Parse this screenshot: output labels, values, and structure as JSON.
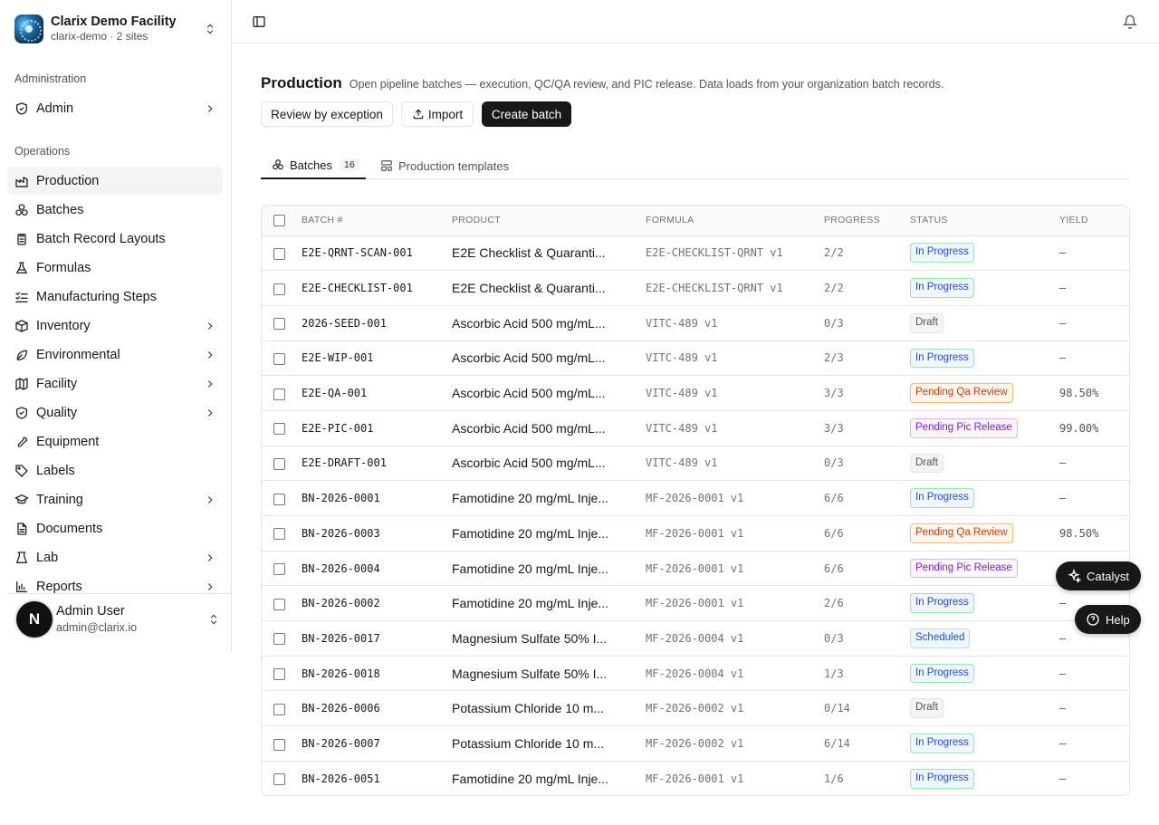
{
  "org": {
    "name": "Clarix Demo Facility",
    "sub": "clarix-demo · 2 sites"
  },
  "sections": {
    "admin": "Administration",
    "operations": "Operations"
  },
  "admin_item": {
    "label": "Admin"
  },
  "nav": [
    {
      "label": "Production",
      "icon": "factory-icon",
      "chevron": false,
      "active": true
    },
    {
      "label": "Batches",
      "icon": "batches-icon",
      "chevron": false
    },
    {
      "label": "Batch Record Layouts",
      "icon": "clipboard-icon",
      "chevron": false
    },
    {
      "label": "Formulas",
      "icon": "flask-icon",
      "chevron": false
    },
    {
      "label": "Manufacturing Steps",
      "icon": "list-checks-icon",
      "chevron": false
    },
    {
      "label": "Inventory",
      "icon": "box-icon",
      "chevron": true
    },
    {
      "label": "Environmental",
      "icon": "leaf-icon",
      "chevron": true
    },
    {
      "label": "Facility",
      "icon": "map-icon",
      "chevron": true
    },
    {
      "label": "Quality",
      "icon": "shield-check-icon",
      "chevron": true
    },
    {
      "label": "Equipment",
      "icon": "wrench-icon",
      "chevron": false
    },
    {
      "label": "Labels",
      "icon": "tag-icon",
      "chevron": false
    },
    {
      "label": "Training",
      "icon": "graduation-cap-icon",
      "chevron": true
    },
    {
      "label": "Documents",
      "icon": "file-icon",
      "chevron": false
    },
    {
      "label": "Lab",
      "icon": "beaker-icon",
      "chevron": true
    },
    {
      "label": "Reports",
      "icon": "chart-icon",
      "chevron": true
    }
  ],
  "user": {
    "initial": "N",
    "name": "Admin User",
    "email": "admin@clarix.io"
  },
  "page": {
    "title": "Production",
    "description": "Open pipeline batches — execution, QC/QA review, and PIC release. Data loads from your organization batch records."
  },
  "actions": {
    "review": "Review by exception",
    "import": "Import",
    "create": "Create batch"
  },
  "tabs": {
    "batches": "Batches",
    "batches_count": "16",
    "templates": "Production templates"
  },
  "table": {
    "headers": {
      "batch": "Batch #",
      "product": "Product",
      "formula": "Formula",
      "progress": "Progress",
      "status": "Status",
      "yield": "Yield"
    },
    "rows": [
      {
        "batch": "E2E-QRNT-SCAN-001",
        "product": "E2E Checklist & Quaranti...",
        "formula": "E2E-CHECKLIST-QRNT v1",
        "progress": "2/2",
        "status": "In Progress",
        "yield": "—"
      },
      {
        "batch": "E2E-CHECKLIST-001",
        "product": "E2E Checklist & Quaranti...",
        "formula": "E2E-CHECKLIST-QRNT v1",
        "progress": "2/2",
        "status": "In Progress",
        "yield": "—"
      },
      {
        "batch": "2026-SEED-001",
        "product": "Ascorbic Acid 500 mg/mL...",
        "formula": "VITC-489 v1",
        "progress": "0/3",
        "status": "Draft",
        "yield": "—"
      },
      {
        "batch": "E2E-WIP-001",
        "product": "Ascorbic Acid 500 mg/mL...",
        "formula": "VITC-489 v1",
        "progress": "2/3",
        "status": "In Progress",
        "yield": "—"
      },
      {
        "batch": "E2E-QA-001",
        "product": "Ascorbic Acid 500 mg/mL...",
        "formula": "VITC-489 v1",
        "progress": "3/3",
        "status": "Pending Qa Review",
        "yield": "98.50%"
      },
      {
        "batch": "E2E-PIC-001",
        "product": "Ascorbic Acid 500 mg/mL...",
        "formula": "VITC-489 v1",
        "progress": "3/3",
        "status": "Pending Pic Release",
        "yield": "99.00%"
      },
      {
        "batch": "E2E-DRAFT-001",
        "product": "Ascorbic Acid 500 mg/mL...",
        "formula": "VITC-489 v1",
        "progress": "0/3",
        "status": "Draft",
        "yield": "—"
      },
      {
        "batch": "BN-2026-0001",
        "product": "Famotidine 20 mg/mL Inje...",
        "formula": "MF-2026-0001 v1",
        "progress": "6/6",
        "status": "In Progress",
        "yield": "—"
      },
      {
        "batch": "BN-2026-0003",
        "product": "Famotidine 20 mg/mL Inje...",
        "formula": "MF-2026-0001 v1",
        "progress": "6/6",
        "status": "Pending Qa Review",
        "yield": "98.50%"
      },
      {
        "batch": "BN-2026-0004",
        "product": "Famotidine 20 mg/mL Inje...",
        "formula": "MF-2026-0001 v1",
        "progress": "6/6",
        "status": "Pending Pic Release",
        "yield": ""
      },
      {
        "batch": "BN-2026-0002",
        "product": "Famotidine 20 mg/mL Inje...",
        "formula": "MF-2026-0001 v1",
        "progress": "2/6",
        "status": "In Progress",
        "yield": "—"
      },
      {
        "batch": "BN-2026-0017",
        "product": "Magnesium Sulfate 50% I...",
        "formula": "MF-2026-0004 v1",
        "progress": "0/3",
        "status": "Scheduled",
        "yield": "—"
      },
      {
        "batch": "BN-2026-0018",
        "product": "Magnesium Sulfate 50% I...",
        "formula": "MF-2026-0004 v1",
        "progress": "1/3",
        "status": "In Progress",
        "yield": "—"
      },
      {
        "batch": "BN-2026-0006",
        "product": "Potassium Chloride 10 m...",
        "formula": "MF-2026-0002 v1",
        "progress": "0/14",
        "status": "Draft",
        "yield": "—"
      },
      {
        "batch": "BN-2026-0007",
        "product": "Potassium Chloride 10 m...",
        "formula": "MF-2026-0002 v1",
        "progress": "6/14",
        "status": "In Progress",
        "yield": "—"
      },
      {
        "batch": "BN-2026-0051",
        "product": "Famotidine 20 mg/mL Inje...",
        "formula": "MF-2026-0001 v1",
        "progress": "1/6",
        "status": "In Progress",
        "yield": "—"
      }
    ]
  },
  "floating": {
    "catalyst": "Catalyst",
    "help": "Help"
  }
}
